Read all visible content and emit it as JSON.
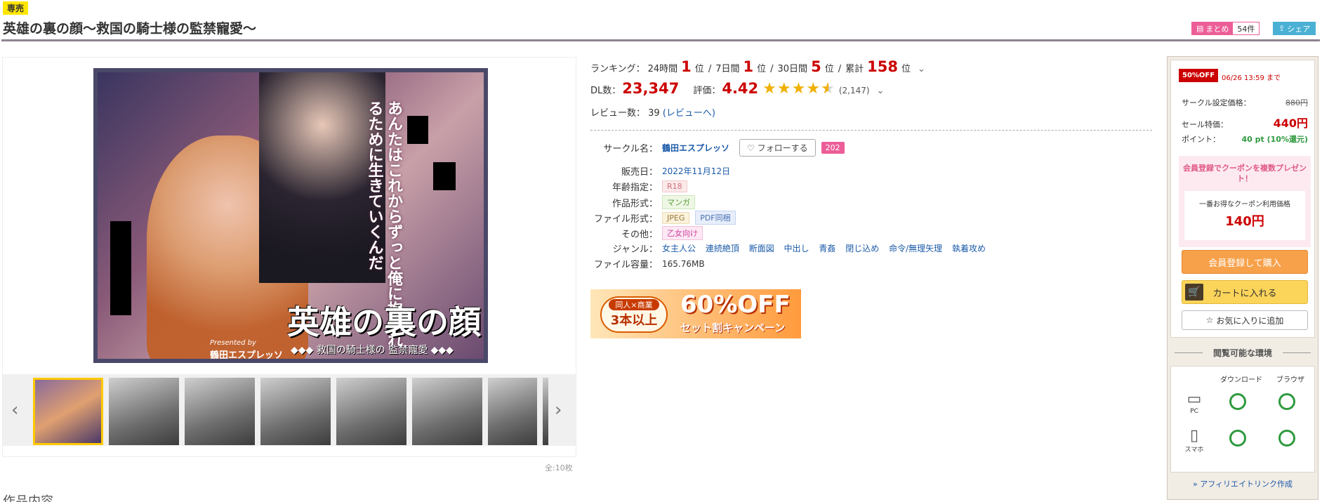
{
  "header": {
    "exclusive_badge": "専売",
    "title": "英雄の裏の顔～救国の騎士様の監禁寵愛～",
    "matome_label": "まとめ",
    "matome_count": "54件",
    "share_label": "シェア"
  },
  "gallery": {
    "main_image_text": {
      "copy": "あんたはこれからずっと俺に抱かれるために生きていくんだ",
      "logo_title": "英雄の裏の顔",
      "logo_subtitle": "◆◆◆ 救国の騎士様の 監禁寵愛 ◆◆◆",
      "presented_by": "Presented by",
      "circle": "鶴田エスプレッソ"
    },
    "thumbnail_count": 7,
    "total_label": "全:10枚"
  },
  "ranking": {
    "label": "ランキング：",
    "h24_label": "24時間",
    "h24_value": "1",
    "d7_label": "7日間",
    "d7_value": "1",
    "d30_label": "30日間",
    "d30_value": "5",
    "total_label": "累計",
    "total_value": "158",
    "unit": "位"
  },
  "stats": {
    "dl_label": "DL数：",
    "dl_value": "23,347",
    "rating_label": "評価：",
    "rating_value": "4.42",
    "rating_fraction": 0.884,
    "rating_count": "(2,147)",
    "review_label": "レビュー数：",
    "review_value": "39",
    "review_link": "(レビューへ)"
  },
  "spec": {
    "circle_label": "サークル名：",
    "circle_value": "鶴田エスプレッソ",
    "follow_label": "フォローする",
    "follower_count": "202",
    "release_label": "販売日：",
    "release_value": "2022年11月12日",
    "age_label": "年齢指定：",
    "age_value": "R18",
    "format_label": "作品形式：",
    "format_value": "マンガ",
    "file_format_label": "ファイル形式：",
    "file_format_values": [
      "JPEG",
      "PDF同梱"
    ],
    "other_label": "その他：",
    "other_value": "乙女向け",
    "genre_label": "ジャンル：",
    "genres": [
      "女主人公",
      "連続絶頂",
      "断面図",
      "中出し",
      "青姦",
      "閉じ込め",
      "命令/無理矢理",
      "執着攻め"
    ],
    "filesize_label": "ファイル容量：",
    "filesize_value": "165.76MB"
  },
  "campaign": {
    "line1": "同人×商業",
    "line2": "3本以上",
    "big": "60%OFF",
    "sub": "セット割キャンペーン"
  },
  "purchase": {
    "sale_badge": "50%OFF",
    "sale_until": "06/26 13:59 まで",
    "circle_price_label": "サークル設定価格：",
    "circle_price_value": "880円",
    "sale_price_label": "セール特価：",
    "sale_price_value": "440円",
    "point_label": "ポイント：",
    "point_value": "40 pt (10%還元)",
    "coupon_text": "会員登録でクーポンを複数プレゼント！",
    "coupon_best_label": "一番お得なクーポン利用価格",
    "coupon_best_price": "140円",
    "register_button": "会員登録して購入",
    "cart_button": "カートに入れる",
    "favorite_button": "お気に入りに追加",
    "env_title": "閲覧可能な環境",
    "env_download": "ダウンロード",
    "env_browser": "ブラウザ",
    "env_pc": "PC",
    "env_phone": "スマホ",
    "affiliate_link": "» アフィリエイトリンク作成"
  },
  "footer": {
    "section_heading_cut": "作品内容"
  },
  "colors": {
    "accent_red": "#c00000",
    "follower_pink": "#ec5e98",
    "share_blue": "#4ab0d4",
    "ok_green": "#2e9a3e"
  }
}
